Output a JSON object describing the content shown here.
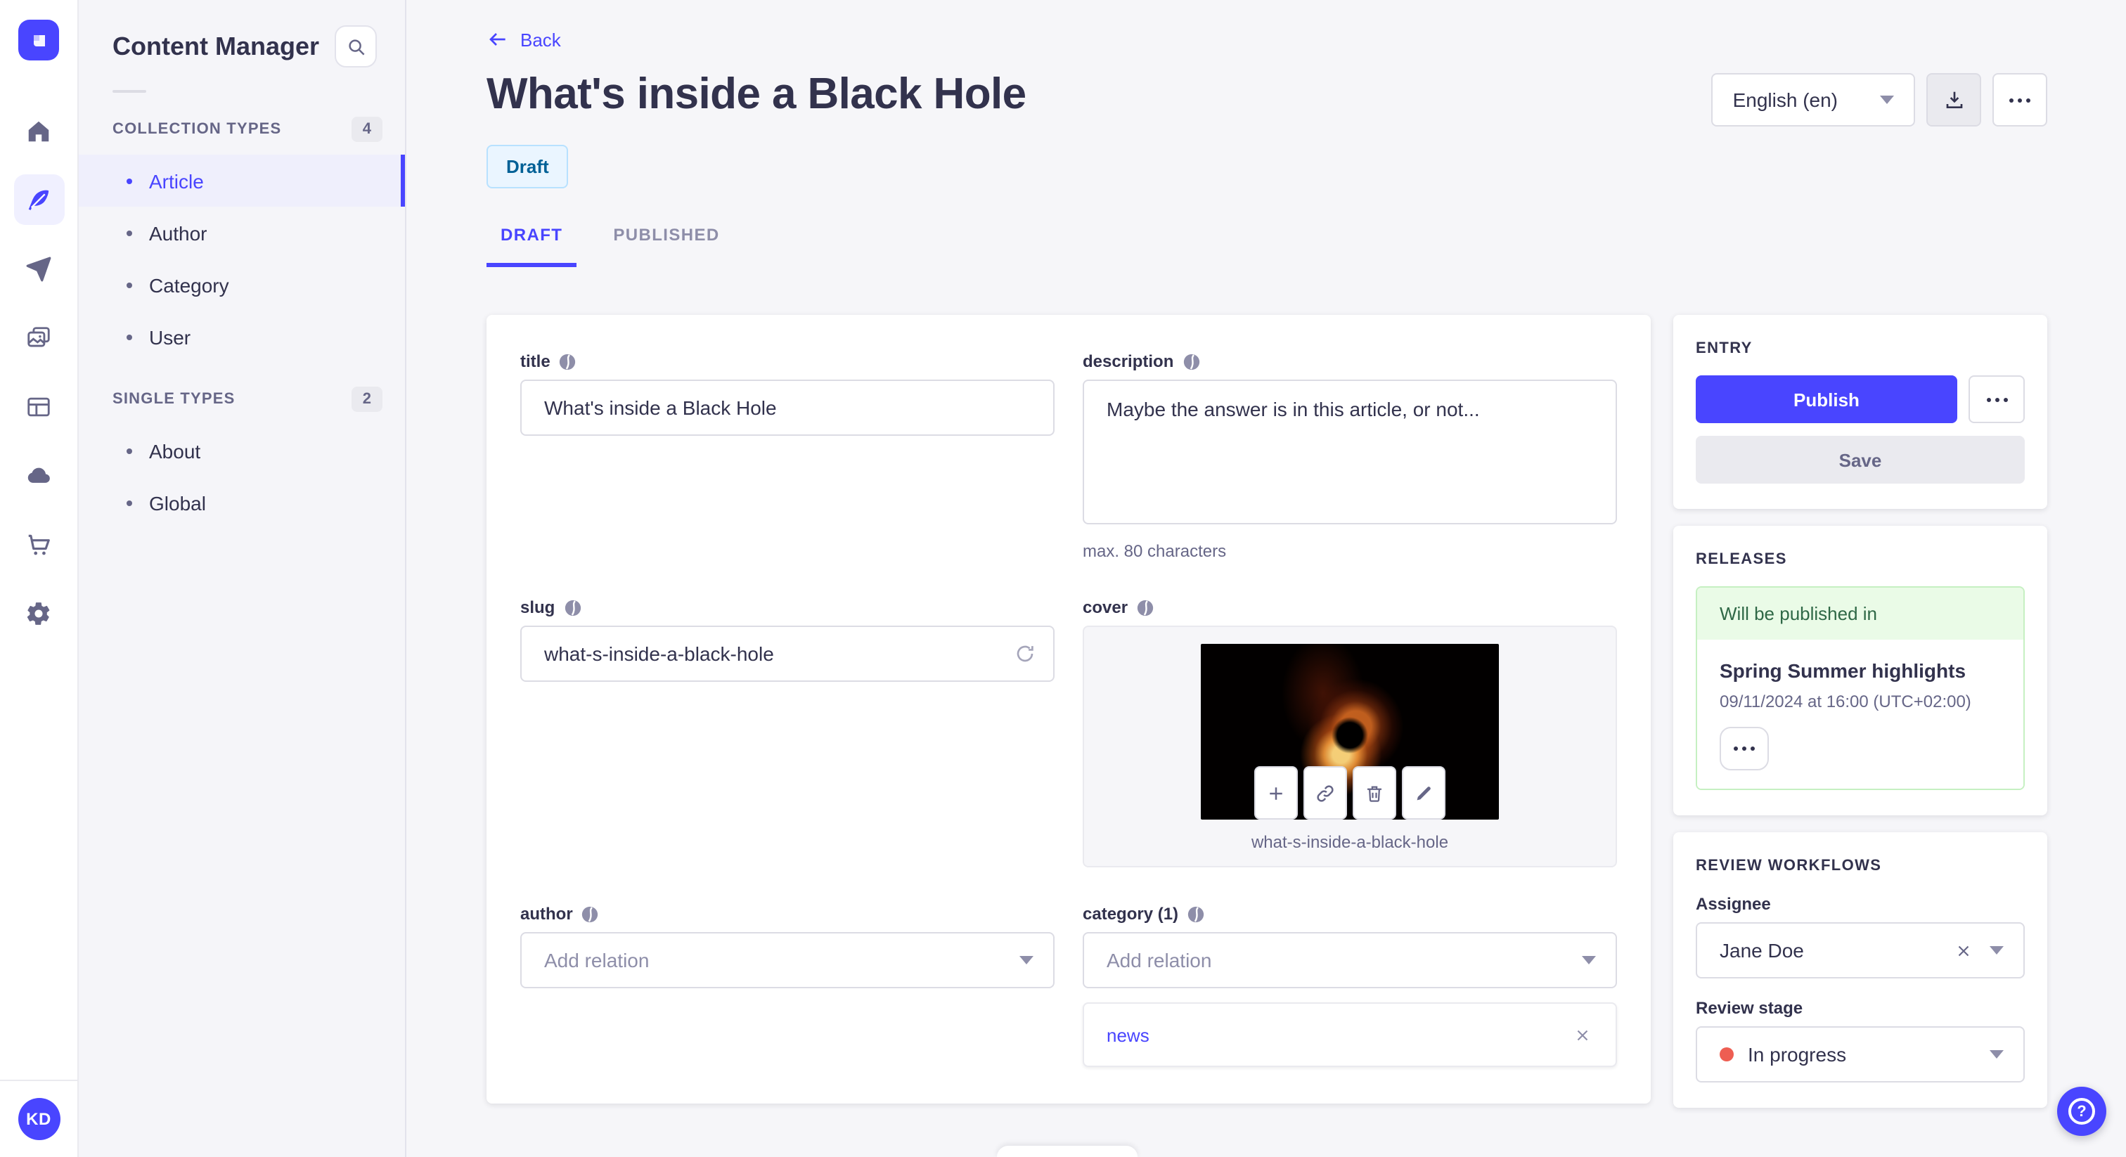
{
  "colors": {
    "primary": "#4945ff",
    "draft_bg": "#eaf5ff",
    "draft_border": "#b8e1ff",
    "draft_text": "#006096",
    "success_bg": "#eafbe7",
    "success_border": "#c6f0c2",
    "success_text": "#2f6846",
    "danger_dot": "#ee5e52"
  },
  "nav": {
    "avatar": "KD",
    "icons": [
      "home-icon",
      "feather-icon",
      "send-icon",
      "media-icon",
      "layout-icon",
      "cloud-icon",
      "cart-icon",
      "gear-icon"
    ]
  },
  "sidebar": {
    "title": "Content Manager",
    "sections": [
      {
        "label": "COLLECTION TYPES",
        "count": "4",
        "items": [
          {
            "label": "Article"
          },
          {
            "label": "Author"
          },
          {
            "label": "Category"
          },
          {
            "label": "User"
          }
        ]
      },
      {
        "label": "SINGLE TYPES",
        "count": "2",
        "items": [
          {
            "label": "About"
          },
          {
            "label": "Global"
          }
        ]
      }
    ]
  },
  "header": {
    "back": "Back",
    "title": "What's inside a Black Hole",
    "status": "Draft",
    "locale": "English (en)",
    "tabs": [
      {
        "label": "DRAFT"
      },
      {
        "label": "PUBLISHED"
      }
    ]
  },
  "form": {
    "title": {
      "label": "title",
      "value": "What's inside a Black Hole"
    },
    "description": {
      "label": "description",
      "value": "Maybe the answer is in this article, or not...",
      "hint": "max. 80 characters"
    },
    "slug": {
      "label": "slug",
      "value": "what-s-inside-a-black-hole"
    },
    "cover": {
      "label": "cover",
      "caption": "what-s-inside-a-black-hole"
    },
    "author": {
      "label": "author",
      "placeholder": "Add relation"
    },
    "category": {
      "label": "category (1)",
      "placeholder": "Add relation",
      "relations": [
        {
          "label": "news"
        }
      ]
    }
  },
  "entry": {
    "heading": "ENTRY",
    "publish": "Publish",
    "save": "Save"
  },
  "releases": {
    "heading": "RELEASES",
    "banner": "Will be published in",
    "name": "Spring Summer highlights",
    "date": "09/11/2024 at 16:00 (UTC+02:00)"
  },
  "review": {
    "heading": "REVIEW WORKFLOWS",
    "assignee_label": "Assignee",
    "assignee": "Jane Doe",
    "stage_label": "Review stage",
    "stage": "In progress"
  },
  "icons": {
    "help": "?"
  }
}
